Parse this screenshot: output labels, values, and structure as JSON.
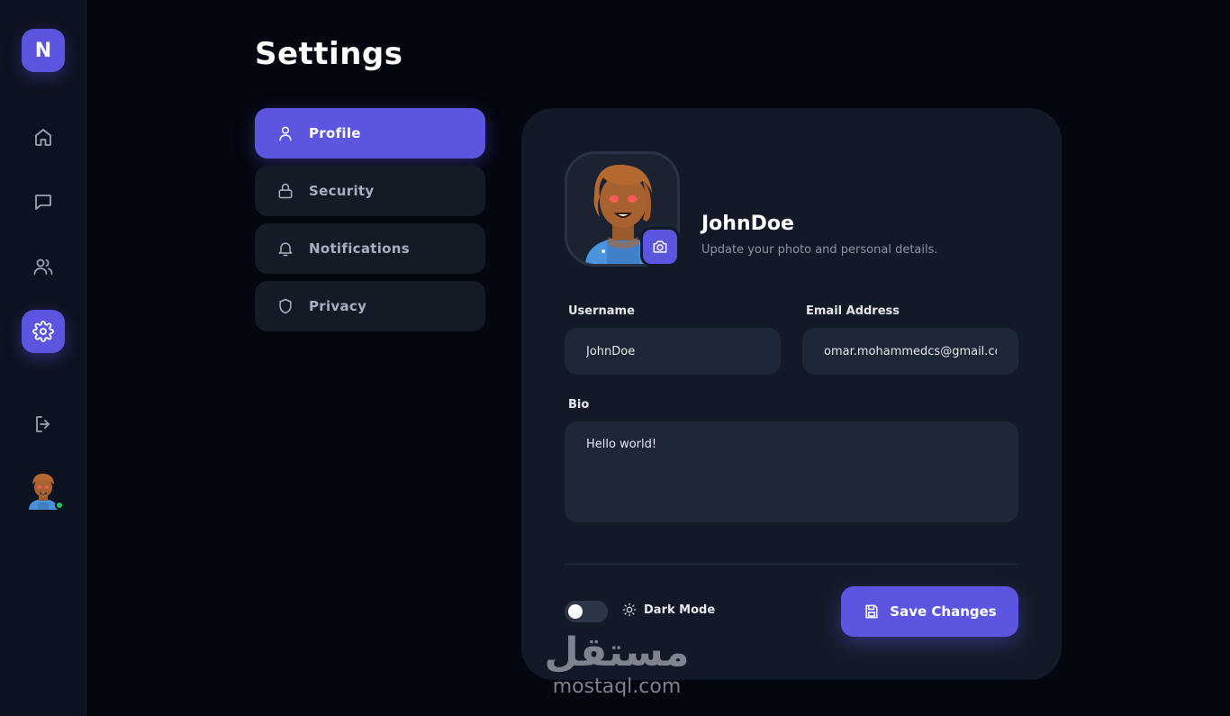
{
  "sidebar": {
    "logo": "N",
    "items": [
      {
        "name": "home",
        "icon": "home-icon"
      },
      {
        "name": "messages",
        "icon": "chat-icon"
      },
      {
        "name": "users",
        "icon": "users-icon"
      },
      {
        "name": "settings",
        "icon": "gear-icon",
        "active": true
      }
    ],
    "logout_icon": "logout-icon",
    "user_status": "online"
  },
  "page": {
    "title": "Settings"
  },
  "settings_menu": {
    "items": [
      {
        "label": "Profile",
        "icon": "user-icon",
        "active": true
      },
      {
        "label": "Security",
        "icon": "lock-icon"
      },
      {
        "label": "Notifications",
        "icon": "bell-icon"
      },
      {
        "label": "Privacy",
        "icon": "shield-icon"
      }
    ]
  },
  "profile": {
    "name": "JohnDoe",
    "subtitle": "Update your photo and personal details.",
    "username_label": "Username",
    "username_value": "JohnDoe",
    "email_label": "Email Address",
    "email_value": "omar.mohammedcs@gmail.com",
    "bio_label": "Bio",
    "bio_value": "Hello world!"
  },
  "footer": {
    "dark_mode_label": "Dark Mode",
    "dark_mode_on": false,
    "save_label": "Save Changes"
  },
  "watermark": {
    "arabic": "مستقل",
    "latin": "mostaql.com"
  },
  "colors": {
    "accent": "#5b55e0",
    "background": "#03070f",
    "card": "#131a27",
    "input": "#1e2738",
    "online": "#22c55e"
  }
}
